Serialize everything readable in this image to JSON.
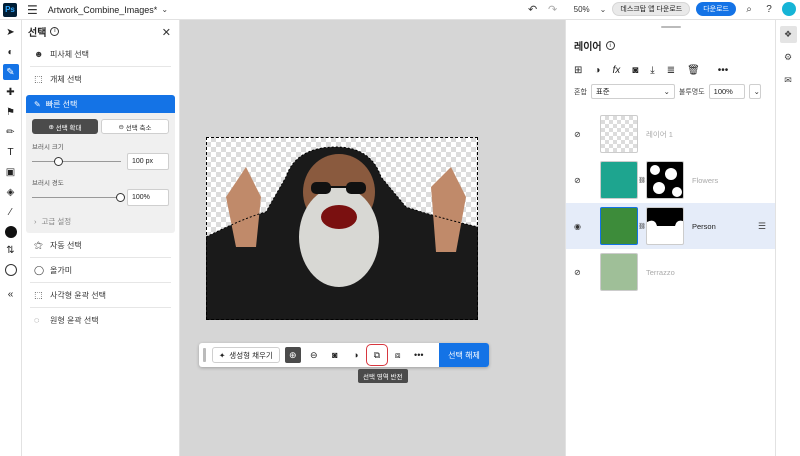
{
  "topbar": {
    "logo": "Ps",
    "doc_title": "Artwork_Combine_Images*",
    "zoom": "50%",
    "desktop_btn": "데스크탑 앱 다운로드",
    "download_btn": "다운로드"
  },
  "selection_panel": {
    "title": "선택",
    "items_top": [
      {
        "label": "피사체 선택",
        "icon": "subject-icon"
      },
      {
        "label": "개체 선택",
        "icon": "object-select-icon"
      }
    ],
    "quick": {
      "label": "빠른 선택",
      "add_label": "선택 확대",
      "subtract_label": "선택 축소",
      "brush_size_label": "브러시 크기",
      "brush_size_value": "100 px",
      "brush_size_level": 0.3,
      "hardness_label": "브러시 경도",
      "hardness_value": "100%",
      "hardness_level": 1.0,
      "advanced_label": "고급 설정"
    },
    "items_bottom": [
      {
        "label": "자동 선택",
        "icon": "magic-wand-icon"
      },
      {
        "label": "올가미",
        "icon": "lasso-icon"
      },
      {
        "label": "사각형 윤곽 선택",
        "icon": "rect-marquee-icon"
      },
      {
        "label": "원형 윤곽 선택",
        "icon": "ellipse-marquee-icon"
      }
    ]
  },
  "context_bar": {
    "gen_fill": "생성형 채우기",
    "deselect": "선택 해제",
    "tooltip": "선택 영역 반전"
  },
  "layers_panel": {
    "title": "레이어",
    "blend_label": "혼합",
    "blend_value": "표준",
    "opacity_label": "불투명도",
    "opacity_value": "100%",
    "layers": [
      {
        "name": "레이어 1",
        "visible": false,
        "selected": false
      },
      {
        "name": "Flowers",
        "visible": false,
        "selected": false
      },
      {
        "name": "Person",
        "visible": true,
        "selected": true
      },
      {
        "name": "Terrazzo",
        "visible": false,
        "selected": false
      }
    ]
  },
  "colors": {
    "accent": "#1473e6",
    "highlight": "#d7373f"
  }
}
